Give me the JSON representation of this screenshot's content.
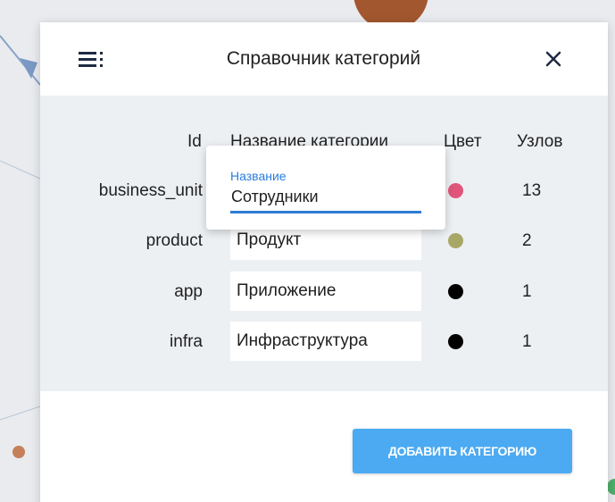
{
  "dialog": {
    "title": "Справочник категорий",
    "menu_icon": "menu-icon",
    "close_icon": "close-icon"
  },
  "table": {
    "headers": {
      "id": "Id",
      "name": "Название категории",
      "color": "Цвет",
      "nodes": "Узлов"
    },
    "rows": [
      {
        "id": "business_unit",
        "name": "",
        "color": "#e0557a",
        "nodes": "13"
      },
      {
        "id": "product",
        "name": "Продукт",
        "color": "#a8a766",
        "nodes": "2"
      },
      {
        "id": "app",
        "name": "Приложение",
        "color": "#000000",
        "nodes": "1"
      },
      {
        "id": "infra",
        "name": "Инфраструктура",
        "color": "#000000",
        "nodes": "1"
      }
    ]
  },
  "edit_popup": {
    "label": "Название",
    "value": "Сотрудники"
  },
  "actions": {
    "add_category": "ДОБАВИТЬ КАТЕГОРИЮ"
  },
  "colors": {
    "accent": "#4baaf2",
    "input_underline": "#2f7bd5",
    "label_blue": "#2a7de1"
  }
}
